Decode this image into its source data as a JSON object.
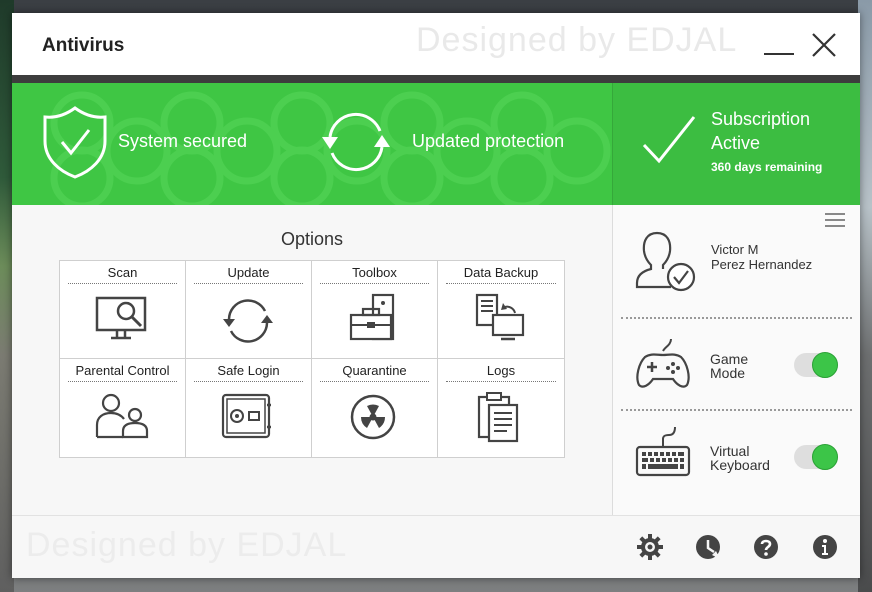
{
  "app": {
    "title": "Antivirus",
    "watermark": "Designed by EDJAL"
  },
  "status": {
    "secured_label": "System secured",
    "updated_label": "Updated protection",
    "subscription_line1": "Subscription",
    "subscription_line2": "Active",
    "days_remaining": "360 days remaining"
  },
  "options": {
    "title": "Options",
    "items": [
      {
        "label": "Scan",
        "icon": "scan-icon"
      },
      {
        "label": "Update",
        "icon": "update-icon"
      },
      {
        "label": "Toolbox",
        "icon": "toolbox-icon"
      },
      {
        "label": "Data Backup",
        "icon": "data-backup-icon"
      },
      {
        "label": "Parental Control",
        "icon": "parental-control-icon"
      },
      {
        "label": "Safe Login",
        "icon": "safe-login-icon"
      },
      {
        "label": "Quarantine",
        "icon": "radiation-icon"
      },
      {
        "label": "Logs",
        "icon": "logs-icon"
      }
    ]
  },
  "sidebar": {
    "user": {
      "first_line": "Victor M",
      "second_line": "Perez Hernandez"
    },
    "game_mode": {
      "line1": "Game",
      "line2": "Mode",
      "enabled": true
    },
    "virtual_keyboard": {
      "line1": "Virtual",
      "line2": "Keyboard",
      "enabled": true
    }
  },
  "footer": {
    "icons": [
      "settings-icon",
      "history-icon",
      "help-icon",
      "info-icon"
    ]
  },
  "colors": {
    "accent_green": "#3fc644",
    "toggle_on": "#3cc548",
    "titlebar_dark": "#3d3d3d"
  }
}
